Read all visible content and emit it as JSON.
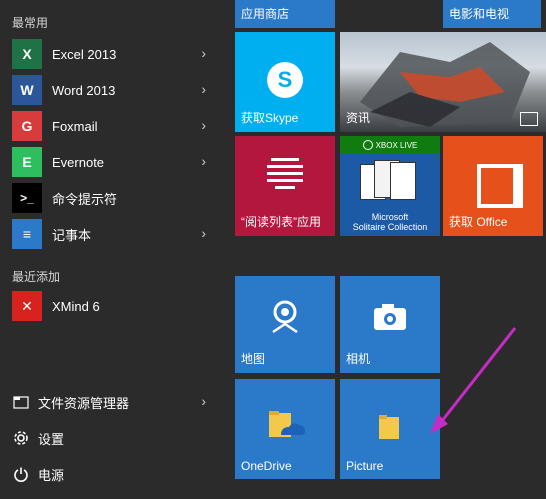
{
  "start_menu": {
    "most_used_title": "最常用",
    "most_used": [
      {
        "label": "Excel 2013",
        "icon": "excel-icon",
        "icon_text": "X",
        "color": "#1f7246",
        "has_submenu": true
      },
      {
        "label": "Word 2013",
        "icon": "word-icon",
        "icon_text": "W",
        "color": "#2b579a",
        "has_submenu": true
      },
      {
        "label": "Foxmail",
        "icon": "foxmail-icon",
        "icon_text": "G",
        "color": "#d73b3b",
        "has_submenu": true
      },
      {
        "label": "Evernote",
        "icon": "evernote-icon",
        "icon_text": "E",
        "color": "#2dbe60",
        "has_submenu": true
      },
      {
        "label": "命令提示符",
        "icon": "command-prompt-icon",
        "icon_text": ">_",
        "color": "#000000",
        "has_submenu": false
      },
      {
        "label": "记事本",
        "icon": "notepad-icon",
        "icon_text": "≡",
        "color": "#2b79c9",
        "has_submenu": true
      }
    ],
    "recent_title": "最近添加",
    "recent": [
      {
        "label": "XMind 6",
        "icon": "xmind-icon",
        "icon_text": "✕",
        "color": "#d8221e"
      }
    ],
    "bottom": [
      {
        "label": "文件资源管理器",
        "icon": "file-explorer-icon",
        "has_submenu": true
      },
      {
        "label": "设置",
        "icon": "settings-gear-icon",
        "has_submenu": false
      },
      {
        "label": "电源",
        "icon": "power-icon",
        "has_submenu": false
      }
    ]
  },
  "tiles": {
    "store_label": "应用商店",
    "tv_label": "电影和电视",
    "skype_label": "获取Skype",
    "news_label": "资讯",
    "reading_label": "“阅读列表”应用",
    "solitaire_badge": "XBOX LIVE",
    "solitaire_label": "Microsoft\nSolitaire Collection",
    "office_label": "获取 Office",
    "maps_label": "地图",
    "camera_label": "相机",
    "onedrive_label": "OneDrive",
    "picture_label": "Picture"
  },
  "colors": {
    "background": "#2b2b2b",
    "tile_blue": "#2b79c9",
    "skype": "#00aff0",
    "maroon": "#b3173e",
    "green": "#0f7a10",
    "orange": "#e6501b",
    "annotation": "#c52cc5"
  }
}
